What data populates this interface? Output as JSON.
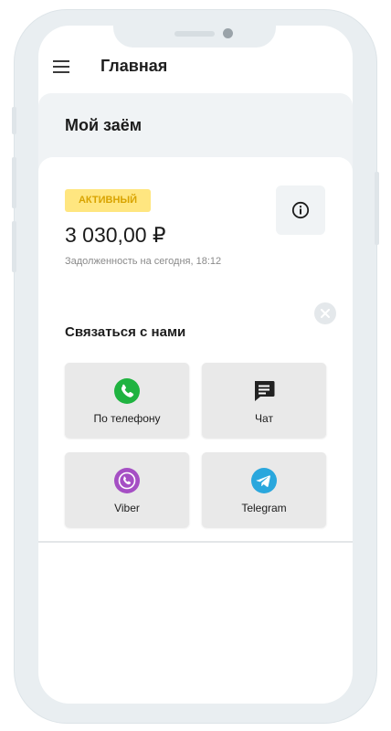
{
  "header": {
    "title": "Главная"
  },
  "loan": {
    "section_title": "Мой заём",
    "status_badge": "АКТИВНЫЙ",
    "amount": "3 030,00 ₽",
    "debt_note": "Задолженность на сегодня, 18:12"
  },
  "contact": {
    "title": "Связаться с нами",
    "options": [
      {
        "label": "По телефону",
        "icon": "phone-icon",
        "color": "#1fb340"
      },
      {
        "label": "Чат",
        "icon": "chat-icon",
        "color": "#222222"
      },
      {
        "label": "Viber",
        "icon": "viber-icon",
        "color": "#a54fc4"
      },
      {
        "label": "Telegram",
        "icon": "telegram-icon",
        "color": "#2aa7dd"
      }
    ]
  },
  "colors": {
    "badge_bg": "#ffe680",
    "badge_text": "#d9a400",
    "panel_bg": "#f0f3f5"
  }
}
